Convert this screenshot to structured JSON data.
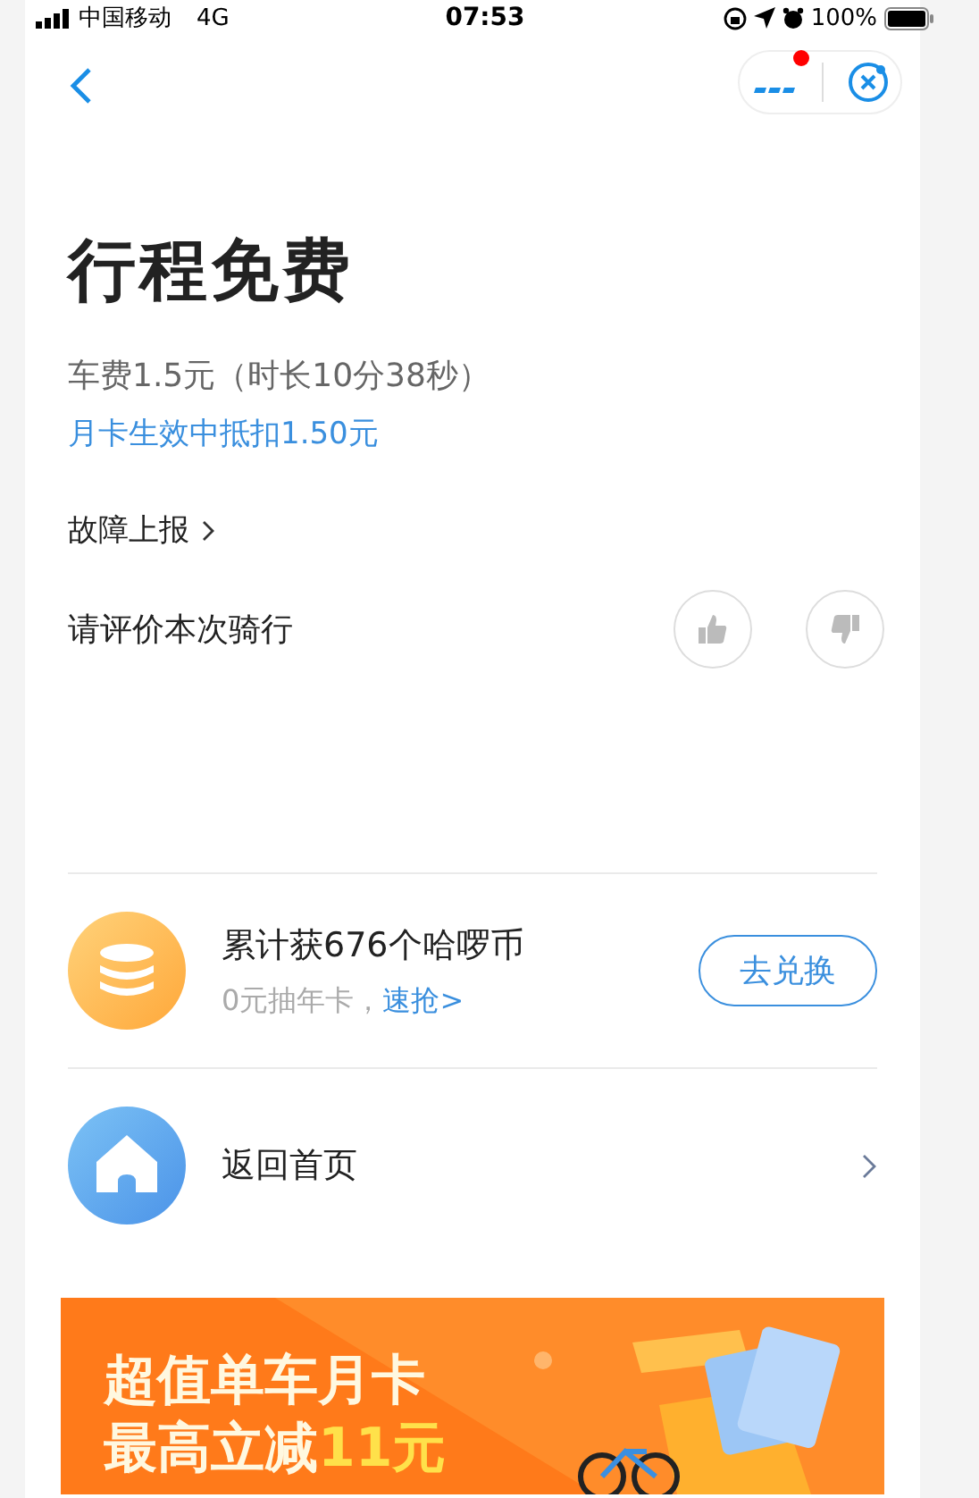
{
  "status_bar": {
    "carrier": "中国移动",
    "network": "4G",
    "time": "07:53",
    "battery": "100%"
  },
  "nav": {
    "has_notification": true
  },
  "title": "行程免费",
  "fare": "车费1.5元（时长10分38秒）",
  "discount": "月卡生效中抵扣1.50元",
  "fault_link": "故障上报",
  "rating": {
    "prompt": "请评价本次骑行",
    "liked": false,
    "disliked": false
  },
  "coins": {
    "title": "累计获676个哈啰币",
    "subtitle": "0元抽年卡，",
    "link": "速抢>",
    "button": "去兑换"
  },
  "home": {
    "label": "返回首页"
  },
  "banner": {
    "line1": "超值单车月卡",
    "line2": "最高立减",
    "highlight": "11元"
  }
}
